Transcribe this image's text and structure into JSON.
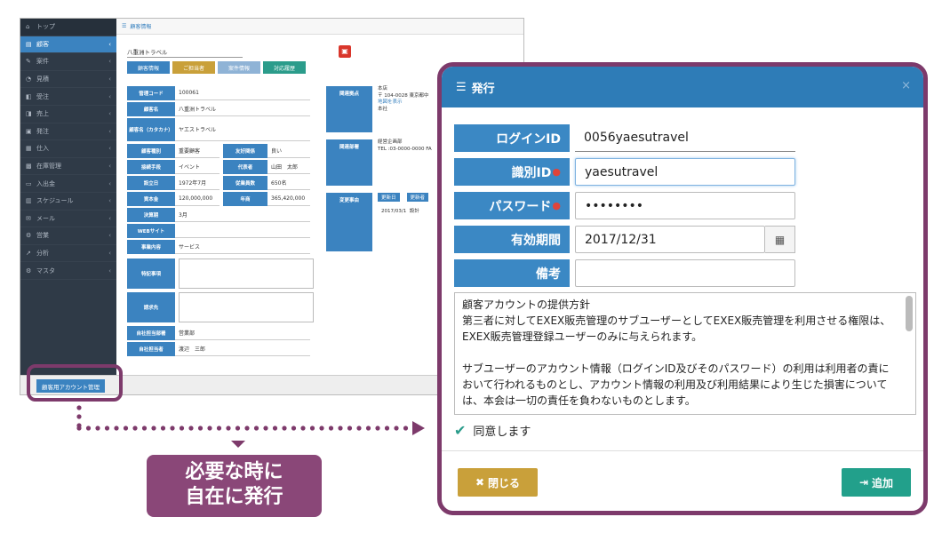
{
  "sidebar": {
    "items": [
      {
        "icon": "home-icon",
        "label": "トップ"
      },
      {
        "icon": "customer-icon",
        "label": "顧客"
      },
      {
        "icon": "edit-icon",
        "label": "案件"
      },
      {
        "icon": "estimate-icon",
        "label": "見積"
      },
      {
        "icon": "order-icon",
        "label": "受注"
      },
      {
        "icon": "sales-icon",
        "label": "売上"
      },
      {
        "icon": "shipment-icon",
        "label": "発注"
      },
      {
        "icon": "purchase-icon",
        "label": "仕入"
      },
      {
        "icon": "inventory-icon",
        "label": "在庫管理"
      },
      {
        "icon": "payment-icon",
        "label": "入出金"
      },
      {
        "icon": "calendar-icon",
        "label": "スケジュール"
      },
      {
        "icon": "mail-icon",
        "label": "メール"
      },
      {
        "icon": "sales-gear-icon",
        "label": "営業"
      },
      {
        "icon": "chart-icon",
        "label": "分析"
      },
      {
        "icon": "master-icon",
        "label": "マスタ"
      }
    ]
  },
  "app": {
    "breadcrumb": "顧客情報",
    "customer_name": "八重洲トラベル",
    "tabs": [
      {
        "label": "顧客情報",
        "color": "#3b83c0"
      },
      {
        "label": "ご担当者",
        "color": "#c9a03a"
      },
      {
        "label": "案件情報",
        "color": "#8fb3d6"
      },
      {
        "label": "対応履歴",
        "color": "#2b9c8b"
      }
    ],
    "fields": {
      "code_label": "管理コード",
      "code": "100061",
      "name_label": "顧客名",
      "name": "八重洲トラベル",
      "kana_label": "顧客名（カタカナ）",
      "kana": "ヤエストラベル",
      "type_label": "顧客種別",
      "type": "重要顧客",
      "rel_label": "友好関係",
      "rel": "良い",
      "channel_label": "接続手段",
      "channel": "イベント",
      "rep_label": "代表者",
      "rep": "山田　太郎",
      "est_label": "設立日",
      "est": "1972年7月",
      "staff_label": "従業員数",
      "staff": "650名",
      "capital_label": "資本金",
      "capital": "120,000,000",
      "sales_label": "年商",
      "sales": "365,420,000",
      "fiscal_label": "決算期",
      "fiscal": "3月",
      "web_label": "WEBサイト",
      "web": "",
      "biz_label": "事業内容",
      "biz": "サービス",
      "notes_label": "特記事項",
      "billing_label": "請求先",
      "dept_label": "自社担当部署",
      "dept": "営業部",
      "person_label": "自社担当者",
      "person": "渡辺　三郎"
    },
    "right": {
      "base_label": "関連拠点",
      "base_text1": "本店",
      "base_text2": "〒 104-0028 東京都中",
      "base_link": "地図を表示",
      "base_text3": "本社",
      "dept_label": "関連部署",
      "dept_text1": "経営企画部",
      "dept_text2": "TEL :03-0000-0000 FA",
      "change_label": "変更事由",
      "change_head1": "更新日",
      "change_head2": "更新者",
      "change_date": "2017/03/1",
      "change_by": "設計"
    },
    "account_button": "顧客用アカウント管理"
  },
  "caption": {
    "line1": "必要な時に",
    "line2": "自在に発行"
  },
  "modal": {
    "title": "発行",
    "close": "×",
    "login_label": "ログインID",
    "login_value": "0056yaesutravel",
    "id_label": "識別ID",
    "id_value": "yaesutravel",
    "pw_label": "パスワード",
    "pw_value": "••••••••",
    "exp_label": "有効期間",
    "exp_value": "2017/12/31",
    "note_label": "備考",
    "note_value": "",
    "required_mark": "●",
    "policy": [
      "顧客アカウントの提供方針",
      "第三者に対してEXEX販売管理のサブユーザーとしてEXEX販売管理を利用させる権限は、EXEX販売管理登録ユーザーのみに与えられます。",
      "",
      "サブユーザーのアカウント情報（ログインID及びそのパスワード）の利用は利用者の責において行われるものとし、アカウント情報の利用及び利用結果により生じた損害については、本会は一切の責任を負わないものとします。"
    ],
    "agree_label": "同意します",
    "close_button": "閉じる",
    "add_button": "追加"
  }
}
